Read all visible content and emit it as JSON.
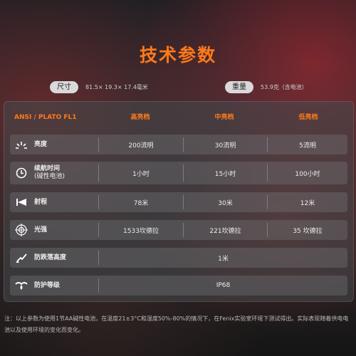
{
  "title": "技术参数",
  "specs": {
    "size_label": "尺寸",
    "size_value": "81.5× 19.3× 17.4毫米",
    "weight_label": "重量",
    "weight_value": "53.9克（含电池）"
  },
  "table": {
    "headers": [
      "ANSI / PLATO FL1",
      "高亮档",
      "中亮档",
      "低亮档"
    ],
    "rows": [
      {
        "icon": "sun-burst-icon",
        "label": "亮度",
        "values": [
          "200流明",
          "30流明",
          "5流明"
        ]
      },
      {
        "icon": "clock-icon",
        "label": "续航时间",
        "sublabel": "(碱性电池)",
        "values": [
          "1小时",
          "15小时",
          "100小时"
        ]
      },
      {
        "icon": "beam-distance-icon",
        "label": "射程",
        "values": [
          "78米",
          "30米",
          "12米"
        ]
      },
      {
        "icon": "target-icon",
        "label": "光强",
        "values": [
          "1533坎德拉",
          "221坎德拉",
          "35 坎德拉"
        ]
      },
      {
        "icon": "impact-icon",
        "label": "防跌落高度",
        "values": [
          "1米"
        ]
      },
      {
        "icon": "water-drop-icon",
        "label": "防护等级",
        "values": [
          "IP68"
        ]
      }
    ]
  },
  "note": "注：以上参数为使用1节AA碱性电池，在温度21±3°C和湿度50%-80%的情况下，在Fenix实验室环境下测试得出。实际表现随着供电电池以及使用环境的变化而变化。"
}
